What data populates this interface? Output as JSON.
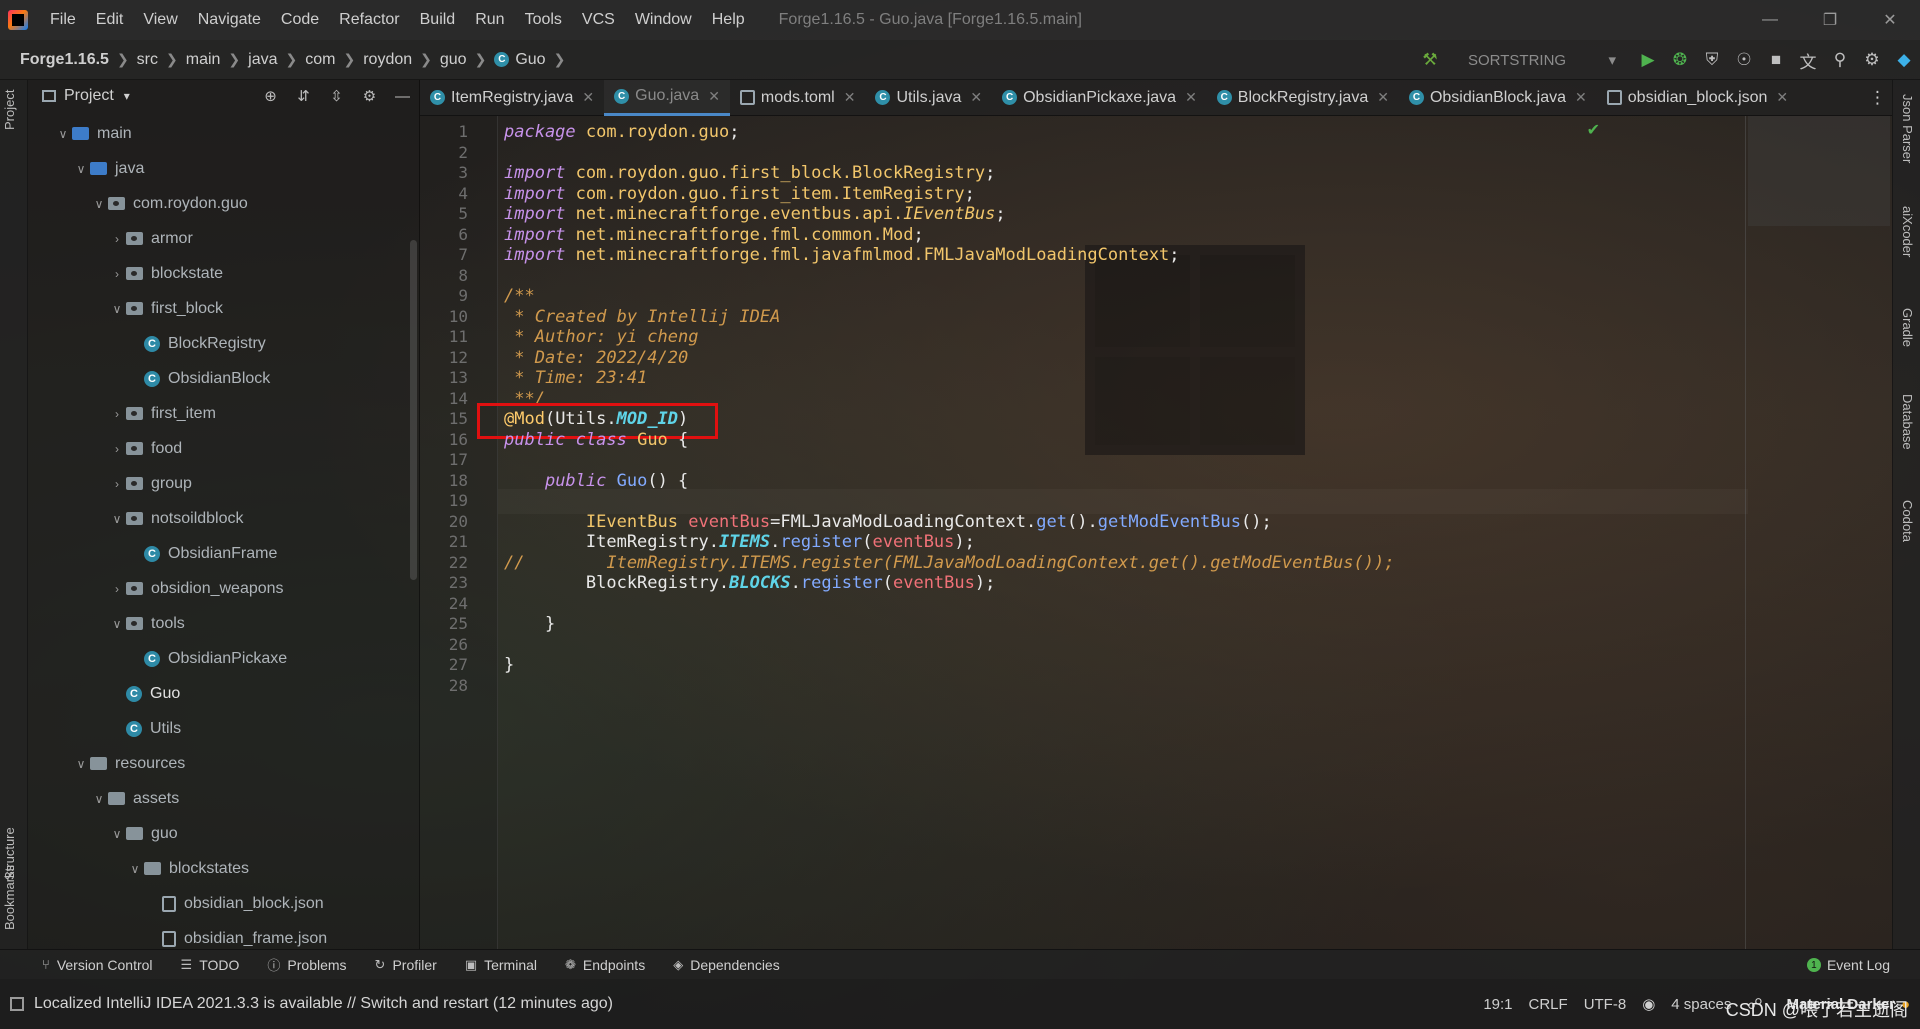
{
  "titlebar": {
    "menus": [
      "File",
      "Edit",
      "View",
      "Navigate",
      "Code",
      "Refactor",
      "Build",
      "Run",
      "Tools",
      "VCS",
      "Window",
      "Help"
    ],
    "window_title": "Forge1.16.5 - Guo.java [Forge1.16.5.main]"
  },
  "breadcrumb": {
    "items": [
      "Forge1.16.5",
      "src",
      "main",
      "java",
      "com",
      "roydon",
      "guo",
      "Guo"
    ],
    "run_config": "SORTSTRING"
  },
  "left_strip": {
    "project": "Project",
    "structure": "Structure",
    "bookmarks": "Bookmarks"
  },
  "right_strip": {
    "json_parser": "Json Parser",
    "aixcoder": "aiXcoder",
    "gradle": "Gradle",
    "database": "Database",
    "codota": "Codota"
  },
  "project_panel": {
    "title": "Project",
    "tree": [
      {
        "label": "main",
        "indent": 1,
        "kind": "folder-blue",
        "open": true
      },
      {
        "label": "java",
        "indent": 2,
        "kind": "folder-blue",
        "open": true
      },
      {
        "label": "com.roydon.guo",
        "indent": 3,
        "kind": "pkg",
        "open": true
      },
      {
        "label": "armor",
        "indent": 4,
        "kind": "pkg",
        "open": false
      },
      {
        "label": "blockstate",
        "indent": 4,
        "kind": "pkg",
        "open": false
      },
      {
        "label": "first_block",
        "indent": 4,
        "kind": "pkg",
        "open": true
      },
      {
        "label": "BlockRegistry",
        "indent": 5,
        "kind": "class"
      },
      {
        "label": "ObsidianBlock",
        "indent": 5,
        "kind": "class"
      },
      {
        "label": "first_item",
        "indent": 4,
        "kind": "pkg",
        "open": false
      },
      {
        "label": "food",
        "indent": 4,
        "kind": "pkg",
        "open": false
      },
      {
        "label": "group",
        "indent": 4,
        "kind": "pkg",
        "open": false
      },
      {
        "label": "notsoildblock",
        "indent": 4,
        "kind": "pkg",
        "open": true
      },
      {
        "label": "ObsidianFrame",
        "indent": 5,
        "kind": "class"
      },
      {
        "label": "obsidion_weapons",
        "indent": 4,
        "kind": "pkg",
        "open": false
      },
      {
        "label": "tools",
        "indent": 4,
        "kind": "pkg",
        "open": true
      },
      {
        "label": "ObsidianPickaxe",
        "indent": 5,
        "kind": "class"
      },
      {
        "label": "Guo",
        "indent": 4,
        "kind": "class",
        "bright": true
      },
      {
        "label": "Utils",
        "indent": 4,
        "kind": "class"
      },
      {
        "label": "resources",
        "indent": 2,
        "kind": "folder",
        "open": true
      },
      {
        "label": "assets",
        "indent": 3,
        "kind": "folder",
        "open": true
      },
      {
        "label": "guo",
        "indent": 4,
        "kind": "folder",
        "open": true
      },
      {
        "label": "blockstates",
        "indent": 5,
        "kind": "folder",
        "open": true
      },
      {
        "label": "obsidian_block.json",
        "indent": 6,
        "kind": "json"
      },
      {
        "label": "obsidian_frame.json",
        "indent": 6,
        "kind": "json"
      }
    ]
  },
  "tabs": [
    {
      "label": "ItemRegistry.java",
      "icon": "class-icon",
      "active": false
    },
    {
      "label": "Guo.java",
      "icon": "class-icon",
      "active": true
    },
    {
      "label": "mods.toml",
      "icon": "toml-file-icon",
      "active": false
    },
    {
      "label": "Utils.java",
      "icon": "class-icon",
      "active": false
    },
    {
      "label": "ObsidianPickaxe.java",
      "icon": "class-icon",
      "active": false
    },
    {
      "label": "BlockRegistry.java",
      "icon": "class-icon",
      "active": false
    },
    {
      "label": "ObsidianBlock.java",
      "icon": "class-icon",
      "active": false
    },
    {
      "label": "obsidian_block.json",
      "icon": "json-file-icon",
      "active": false
    }
  ],
  "editor": {
    "highlighted_line": 15,
    "current_line": 19,
    "lines": [
      [
        [
          "kw",
          "package"
        ],
        [
          "txt",
          " "
        ],
        [
          "pkg",
          "com.roydon.guo"
        ],
        [
          "txt",
          ";"
        ]
      ],
      [],
      [
        [
          "kw",
          "import"
        ],
        [
          "txt",
          " "
        ],
        [
          "pkg",
          "com.roydon.guo.first_block.BlockRegistry"
        ],
        [
          "txt",
          ";"
        ]
      ],
      [
        [
          "kw",
          "import"
        ],
        [
          "txt",
          " "
        ],
        [
          "pkg",
          "com.roydon.guo.first_item.ItemRegistry"
        ],
        [
          "txt",
          ";"
        ]
      ],
      [
        [
          "kw",
          "import"
        ],
        [
          "txt",
          " "
        ],
        [
          "pkg",
          "net.minecraftforge.eventbus.api."
        ],
        [
          "iface",
          "IEventBus"
        ],
        [
          "txt",
          ";"
        ]
      ],
      [
        [
          "kw",
          "import"
        ],
        [
          "txt",
          " "
        ],
        [
          "pkg",
          "net.minecraftforge.fml.common.Mod"
        ],
        [
          "txt",
          ";"
        ]
      ],
      [
        [
          "kw",
          "import"
        ],
        [
          "txt",
          " "
        ],
        [
          "pkg",
          "net.minecraftforge.fml.javafmlmod.FMLJavaModLoadingContext"
        ],
        [
          "txt",
          ";"
        ]
      ],
      [],
      [
        [
          "cmt",
          "/**"
        ]
      ],
      [
        [
          "cmt",
          " * Created by Intellij IDEA"
        ]
      ],
      [
        [
          "cmt",
          " * Author: yi cheng"
        ]
      ],
      [
        [
          "cmt",
          " * Date: 2022/4/20"
        ]
      ],
      [
        [
          "cmt",
          " * Time: 23:41"
        ]
      ],
      [
        [
          "cmt",
          " **/"
        ]
      ],
      [
        [
          "ann",
          "@Mod"
        ],
        [
          "txt",
          "(Utils."
        ],
        [
          "const",
          "MOD_ID"
        ],
        [
          "txt",
          ")"
        ]
      ],
      [
        [
          "kw",
          "public class"
        ],
        [
          "txt",
          " "
        ],
        [
          "cls-name",
          "Guo"
        ],
        [
          "txt",
          " {"
        ]
      ],
      [],
      [
        [
          "txt",
          "    "
        ],
        [
          "kw",
          "public"
        ],
        [
          "txt",
          " "
        ],
        [
          "fn",
          "Guo"
        ],
        [
          "txt",
          "() {"
        ]
      ],
      [],
      [
        [
          "txt",
          "        "
        ],
        [
          "cls-name",
          "IEventBus"
        ],
        [
          "txt",
          " "
        ],
        [
          "var",
          "eventBus"
        ],
        [
          "txt",
          "=FMLJavaModLoadingContext."
        ],
        [
          "fn",
          "get"
        ],
        [
          "txt",
          "()."
        ],
        [
          "fn",
          "getModEventBus"
        ],
        [
          "txt",
          "();"
        ]
      ],
      [
        [
          "txt",
          "        ItemRegistry."
        ],
        [
          "const",
          "ITEMS"
        ],
        [
          "txt",
          "."
        ],
        [
          "fn",
          "register"
        ],
        [
          "txt",
          "("
        ],
        [
          "var",
          "eventBus"
        ],
        [
          "txt",
          ");"
        ]
      ],
      [
        [
          "cmt",
          "//        ItemRegistry.ITEMS.register(FMLJavaModLoadingContext.get().getModEventBus());"
        ]
      ],
      [
        [
          "txt",
          "        BlockRegistry."
        ],
        [
          "const",
          "BLOCKS"
        ],
        [
          "txt",
          "."
        ],
        [
          "fn",
          "register"
        ],
        [
          "txt",
          "("
        ],
        [
          "var",
          "eventBus"
        ],
        [
          "txt",
          ");"
        ]
      ],
      [],
      [
        [
          "txt",
          "    }"
        ]
      ],
      [],
      [
        [
          "txt",
          "}"
        ]
      ],
      []
    ]
  },
  "tool_windows": [
    {
      "label": "Version Control",
      "icon": "branch-icon"
    },
    {
      "label": "TODO",
      "icon": "list-icon"
    },
    {
      "label": "Problems",
      "icon": "warning-icon"
    },
    {
      "label": "Profiler",
      "icon": "profiler-icon"
    },
    {
      "label": "Terminal",
      "icon": "terminal-icon"
    },
    {
      "label": "Endpoints",
      "icon": "endpoints-icon"
    },
    {
      "label": "Dependencies",
      "icon": "dependencies-icon"
    }
  ],
  "event_log": "Event Log",
  "status": {
    "message": "Localized IntelliJ IDEA 2021.3.3 is available // Switch and restart (12 minutes ago)",
    "position": "19:1",
    "line_sep": "CRLF",
    "encoding": "UTF-8",
    "indent": "4 spaces",
    "theme": "Material Darker"
  },
  "watermark": "CSDN @喂了若主逝阁"
}
